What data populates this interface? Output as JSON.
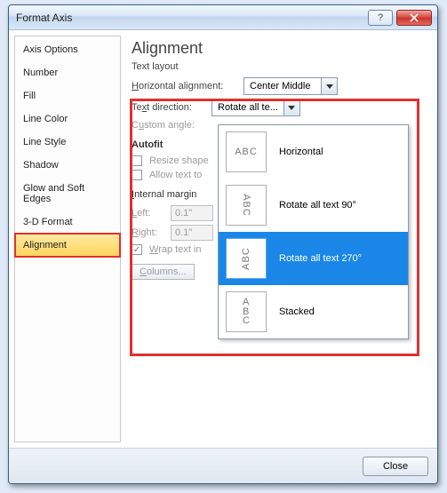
{
  "window": {
    "title": "Format Axis"
  },
  "sidebar": {
    "items": [
      {
        "label": "Axis Options"
      },
      {
        "label": "Number"
      },
      {
        "label": "Fill"
      },
      {
        "label": "Line Color"
      },
      {
        "label": "Line Style"
      },
      {
        "label": "Shadow"
      },
      {
        "label": "Glow and Soft Edges"
      },
      {
        "label": "3-D Format"
      },
      {
        "label": "Alignment"
      }
    ],
    "selected": "Alignment"
  },
  "panel": {
    "heading": "Alignment",
    "text_layout": "Text layout",
    "horizontal_alignment_label": "Horizontal alignment:",
    "horizontal_alignment_value": "Center Middle",
    "text_direction_label": "Text direction:",
    "text_direction_value": "Rotate all te...",
    "custom_angle_label": "Custom angle:",
    "autofit": "Autofit",
    "resize_shape": "Resize shape",
    "allow_text_to": "Allow text to",
    "internal_margin": "Internal margin",
    "left_label": "Left:",
    "left_value": "0.1\"",
    "right_label": "Right:",
    "right_value": "0.1\"",
    "wrap_text": "Wrap text in",
    "columns_btn": "Columns..."
  },
  "dropdown": {
    "items": [
      {
        "label": "Horizontal"
      },
      {
        "label": "Rotate all text 90°"
      },
      {
        "label": "Rotate all text 270°"
      },
      {
        "label": "Stacked"
      }
    ]
  },
  "footer": {
    "close": "Close"
  },
  "icons": {
    "abc": "ABC",
    "a": "A",
    "b": "B",
    "c": "C"
  }
}
